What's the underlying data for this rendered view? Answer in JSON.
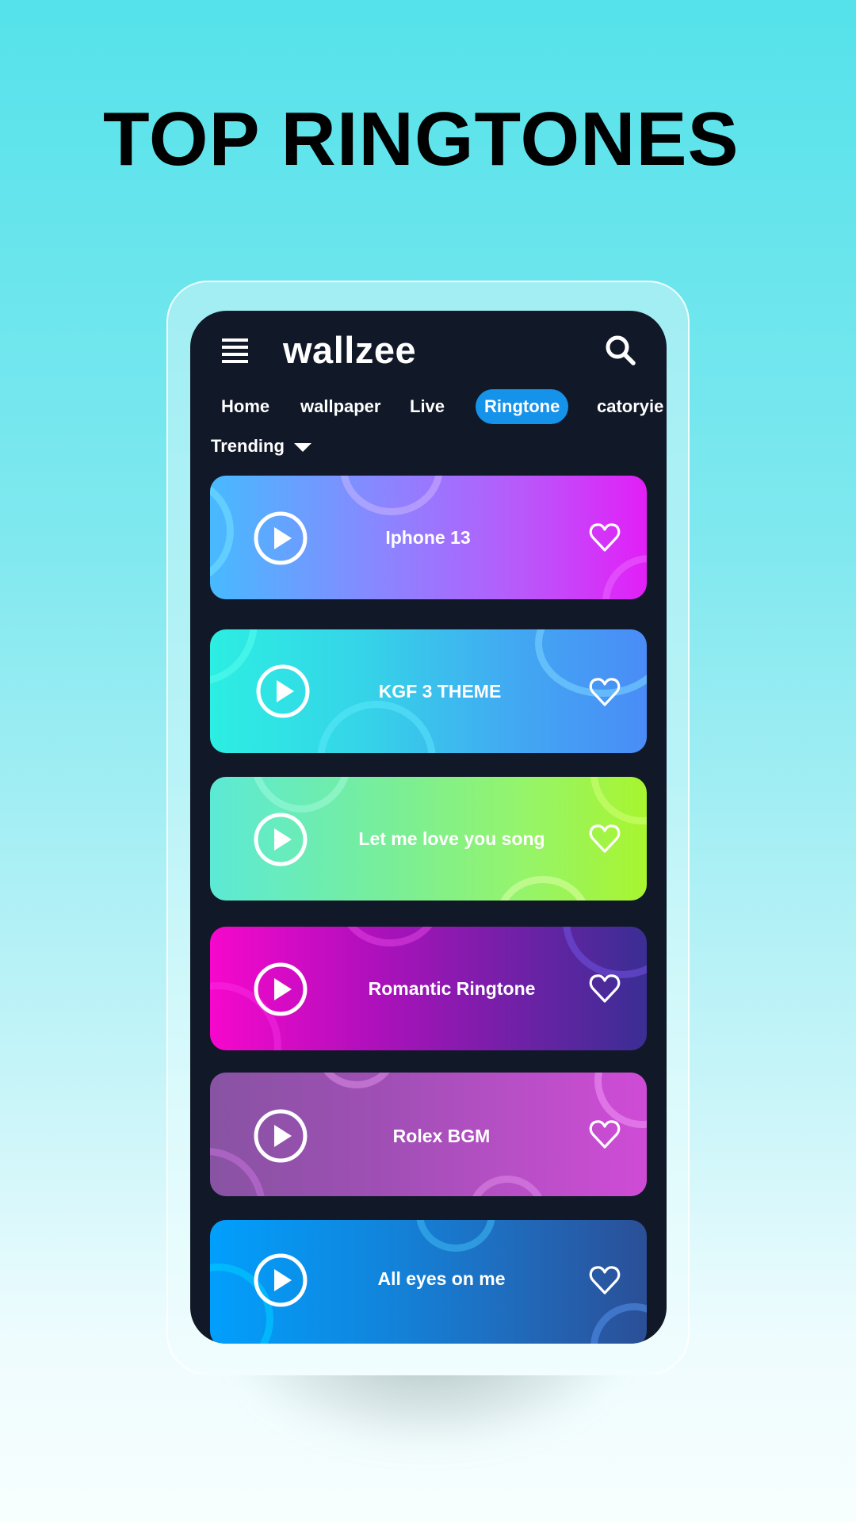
{
  "headline": "TOP RINGTONES",
  "app": {
    "logo": "wallzee",
    "menu_icon": "hamburger-menu-icon",
    "search_icon": "search-icon"
  },
  "tabs": [
    {
      "label": "Home",
      "active": false
    },
    {
      "label": "wallpaper",
      "active": false
    },
    {
      "label": "Live",
      "active": false
    },
    {
      "label": "Ringtone",
      "active": true
    },
    {
      "label": "catoryie",
      "active": false
    }
  ],
  "filter": {
    "label": "Trending",
    "icon": "caret-down-icon"
  },
  "ringtones": [
    {
      "title": "Iphone 13",
      "play_icon": "play-circle-icon",
      "favorite_icon": "heart-outline-icon",
      "gradient": [
        "#47baff",
        "#8b85ff",
        "#e21ff7"
      ]
    },
    {
      "title": "KGF 3 THEME",
      "play_icon": "play-circle-icon",
      "favorite_icon": "heart-outline-icon",
      "gradient": [
        "#2ceee2",
        "#3ec3ee",
        "#4a8cf7"
      ]
    },
    {
      "title": "Let me love you song",
      "play_icon": "play-circle-icon",
      "favorite_icon": "heart-outline-icon",
      "gradient": [
        "#5cead6",
        "#8ef27a",
        "#a8f52f"
      ]
    },
    {
      "title": "Romantic Ringtone",
      "play_icon": "play-circle-icon",
      "favorite_icon": "heart-outline-icon",
      "gradient": [
        "#f707cc",
        "#8a1cb0",
        "#3a2e94"
      ]
    },
    {
      "title": "Rolex BGM",
      "play_icon": "play-circle-icon",
      "favorite_icon": "heart-outline-icon",
      "gradient": [
        "#8853a3",
        "#ad4fbd",
        "#cf4bd6"
      ]
    },
    {
      "title": "All eyes on me",
      "play_icon": "play-circle-icon",
      "favorite_icon": "heart-outline-icon",
      "gradient": [
        "#019ffc",
        "#1e75c8",
        "#2b4f97"
      ]
    }
  ],
  "colors": {
    "screen_bg": "#111827",
    "active_tab": "#1592e9"
  }
}
